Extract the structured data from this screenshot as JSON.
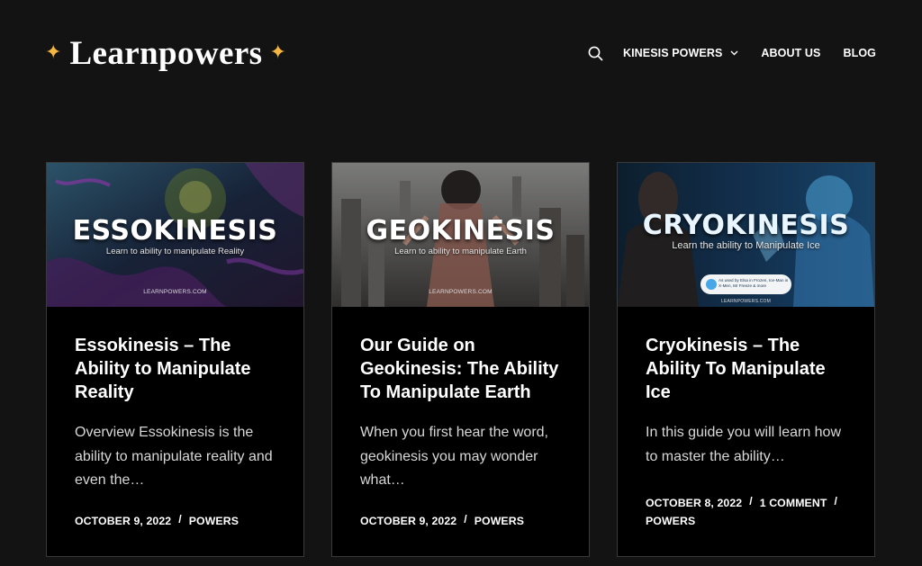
{
  "site": {
    "brand": "Learnpowers",
    "star": "✦"
  },
  "nav": {
    "items": [
      {
        "label": "KINESIS POWERS"
      },
      {
        "label": "ABOUT US"
      },
      {
        "label": "BLOG"
      }
    ]
  },
  "colors": {
    "background": "#131313",
    "card": "#000000",
    "accent": "#f5b541"
  },
  "posts": [
    {
      "thumb_title": "ESSOKINESIS",
      "thumb_subtitle": "Learn to ability to manipulate Reality",
      "thumb_site": "LEARNPOWERS.COM",
      "title": "Essokinesis – The Ability to Manipulate Reality",
      "excerpt": "Overview Essokinesis is the ability to manipulate reality and even the…",
      "date": "OCTOBER 9, 2022",
      "meta2": "POWERS"
    },
    {
      "thumb_title": "GEOKINESIS",
      "thumb_subtitle": "Learn to ability to manipulate Earth",
      "thumb_site": "LEARNPOWERS.COM",
      "title": "Our Guide on Geokinesis: The Ability To Manipulate Earth",
      "excerpt": "When you first hear the word, geokinesis you may wonder what…",
      "date": "OCTOBER 9, 2022",
      "meta2": "POWERS"
    },
    {
      "thumb_title": "CRYOKINESIS",
      "thumb_subtitle": "Learn the ability to Manipulate Ice",
      "thumb_badge": "As used by Elsa in Frozen, Ice-Man in X-Men, Mr Freeze & more",
      "thumb_site": "LEARNPOWERS.COM",
      "title": "Cryokinesis – The Ability To Manipulate Ice",
      "excerpt": "In this guide you will learn how to master the ability…",
      "date": "OCTOBER 8, 2022",
      "comments": "1 COMMENT",
      "meta2": "POWERS"
    }
  ]
}
